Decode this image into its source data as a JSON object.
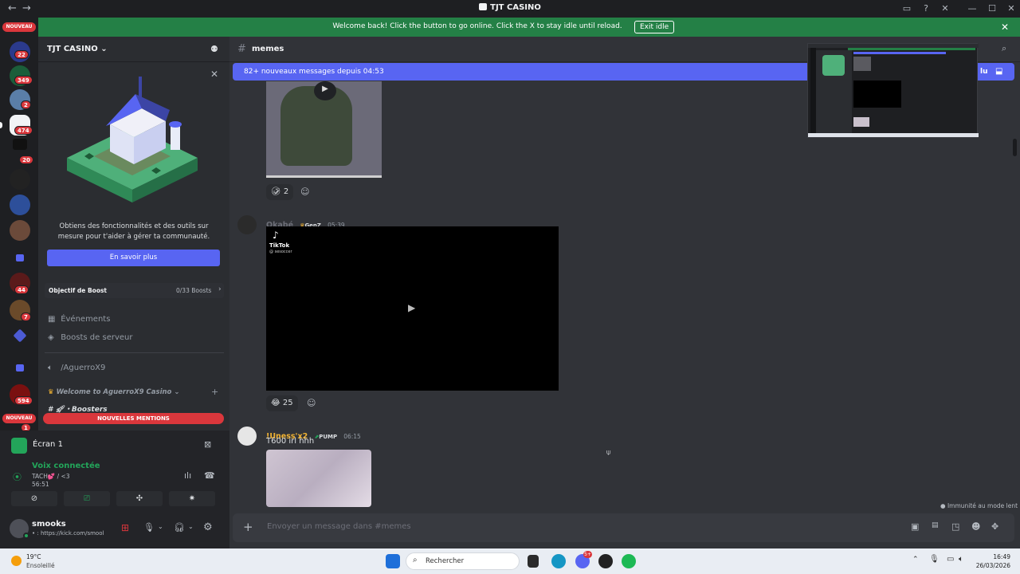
{
  "window": {
    "title": "TJT CASINO",
    "back_glyph": "←",
    "forward_glyph": "→"
  },
  "banner": {
    "message": "Welcome back! Click the button to go online. Click the X to stay idle until reload.",
    "exit_label": "Exit idle",
    "close_glyph": "✕"
  },
  "rail": {
    "top_badge": "NOUVEAU",
    "bottom_badge": "NOUVEAU",
    "badges": [
      "22",
      "349",
      "2",
      "474",
      "20",
      "44",
      "7",
      "594",
      "1"
    ]
  },
  "sidebar": {
    "guild_name": "TJT CASINO ⌄",
    "promo_text": "Obtiens des fonctionnalités et des outils sur mesure pour t'aider à gérer ta communauté.",
    "promo_button": "En savoir plus",
    "boost_goal_label": "Objectif de Boost",
    "boost_goal_value": "0/33 Boosts",
    "items": {
      "events": "Événements",
      "server_boosts": "Boosts de serveur",
      "voice": "/AguerroX9",
      "category": "Welcome to AguerroX9 Casino",
      "boosters": "・Boosters"
    },
    "new_mentions": "NOUVELLES MENTIONS"
  },
  "user_area": {
    "stream_title": "Écran 1",
    "voice_status": "Voix connectée",
    "voice_channel": "TACH💕 / <3",
    "voice_timer": "56:51",
    "username": "smooks",
    "user_status": "• : https://kick.com/smool"
  },
  "chat": {
    "channel_name": "memes",
    "new_messages": "82+ nouveaux messages depuis 04:53",
    "mark_read": "lu",
    "messages": [
      {
        "author": "Okabé",
        "author_color": "#6d6f78",
        "tag": "GenZ",
        "time": "05:39",
        "embed_brand": "TikTok",
        "embed_handle": "@ sesoccer",
        "reaction_count": "25"
      },
      {
        "author": "!Uness'x2",
        "author_color": "#f0b232",
        "tag": "PUMP",
        "time": "06:15",
        "text": "T600 irl hhh"
      }
    ],
    "first_reaction_count": "2",
    "slow_mode_note": "Immunité au mode lent",
    "composer_placeholder": "Envoyer un message dans #memes"
  },
  "taskbar": {
    "weather_temp": "19°C",
    "weather_desc": "Ensoleillé",
    "search_placeholder": "Rechercher",
    "discord_badge": "5+",
    "clock_time": "16:49",
    "clock_date": "26/03/2026"
  },
  "colors": {
    "accent": "#5865f2",
    "banner_green": "#248046",
    "voice_green": "#23a55a",
    "danger": "#da373c"
  }
}
